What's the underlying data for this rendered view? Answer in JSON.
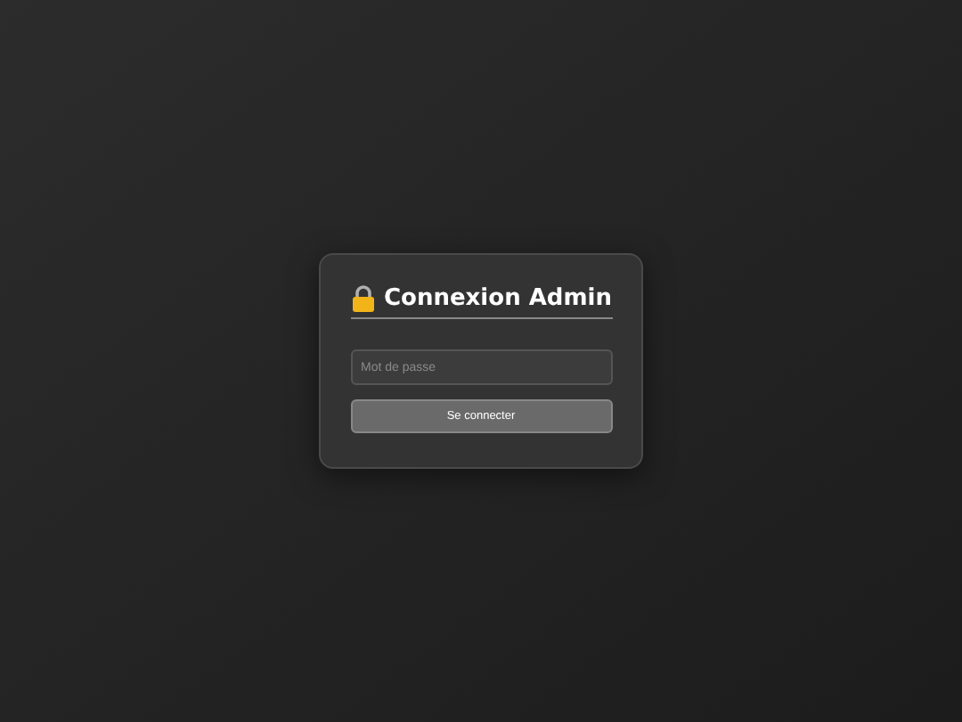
{
  "login": {
    "title": "Connexion Admin",
    "password": {
      "placeholder": "Mot de passe"
    },
    "button": "Se connecter"
  }
}
